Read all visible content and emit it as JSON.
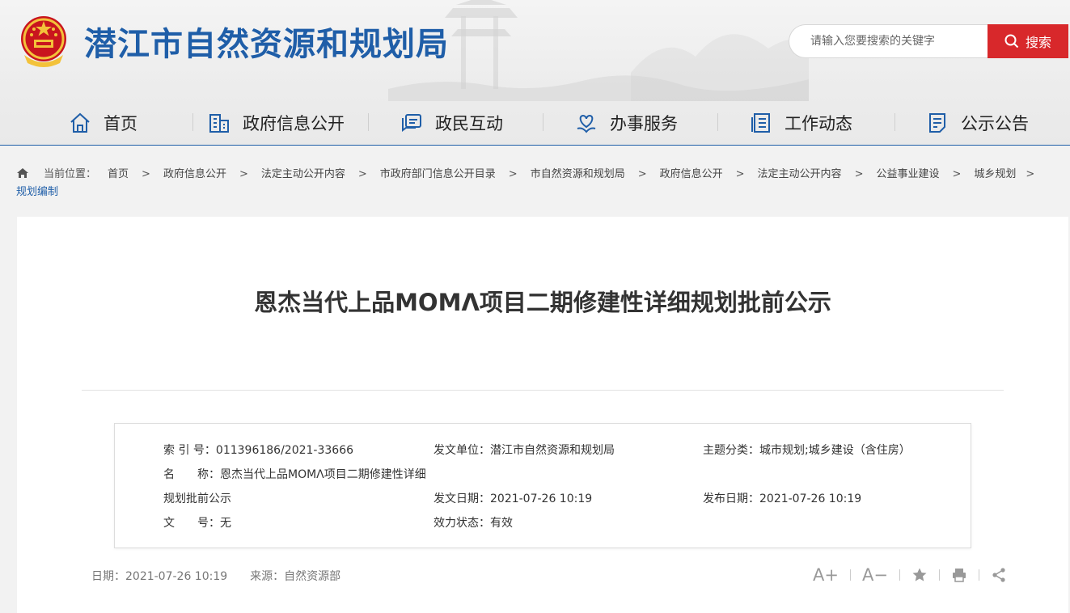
{
  "header": {
    "site_title": "潜江市自然资源和规划局",
    "search_placeholder": "请输入您要搜索的关键字",
    "search_button": "搜索"
  },
  "nav": {
    "items": [
      {
        "label": "首页",
        "icon": "home-icon"
      },
      {
        "label": "政府信息公开",
        "icon": "building-icon"
      },
      {
        "label": "政民互动",
        "icon": "chat-icon"
      },
      {
        "label": "办事服务",
        "icon": "heart-hand-icon"
      },
      {
        "label": "工作动态",
        "icon": "document-list-icon"
      },
      {
        "label": "公示公告",
        "icon": "notice-icon"
      }
    ]
  },
  "breadcrumb": {
    "prefix": "当前位置：",
    "items": [
      "首页",
      "政府信息公开",
      "法定主动公开内容",
      "市政府部门信息公开目录",
      "市自然资源和规划局",
      "政府信息公开",
      "法定主动公开内容",
      "公益事业建设",
      "城乡规划"
    ],
    "current": "规划编制",
    "separator": ">"
  },
  "article": {
    "title": "恩杰当代上品MOMΛ项目二期修建性详细规划批前公示",
    "info": {
      "index_label": "索 引 号：",
      "index_value": "011396186/2021-33666",
      "issuer_label": "发文单位：",
      "issuer_value": "潜江市自然资源和规划局",
      "topic_label": "主题分类：",
      "topic_value": "城市规划;城乡建设（含住房）",
      "name_label_1": "名",
      "name_label_2": "称：",
      "name_value_line1": "恩杰当代上品MOMΛ项目二期修建性详细",
      "name_value_line2": "规划批前公示",
      "issue_date_label": "发文日期：",
      "issue_date_value": "2021-07-26 10:19",
      "publish_date_label": "发布日期：",
      "publish_date_value": "2021-07-26 10:19",
      "doc_no_label_1": "文",
      "doc_no_label_2": "号：",
      "doc_no_value": "无",
      "status_label": "效力状态：",
      "status_value": "有效"
    },
    "meta": {
      "date": "日期：2021-07-26 10:19",
      "source": "来源：自然资源部"
    },
    "tools": {
      "font_up": "A+",
      "font_down": "A−"
    }
  },
  "colors": {
    "brand_blue": "#1f5ea8",
    "search_red": "#d8282b"
  }
}
